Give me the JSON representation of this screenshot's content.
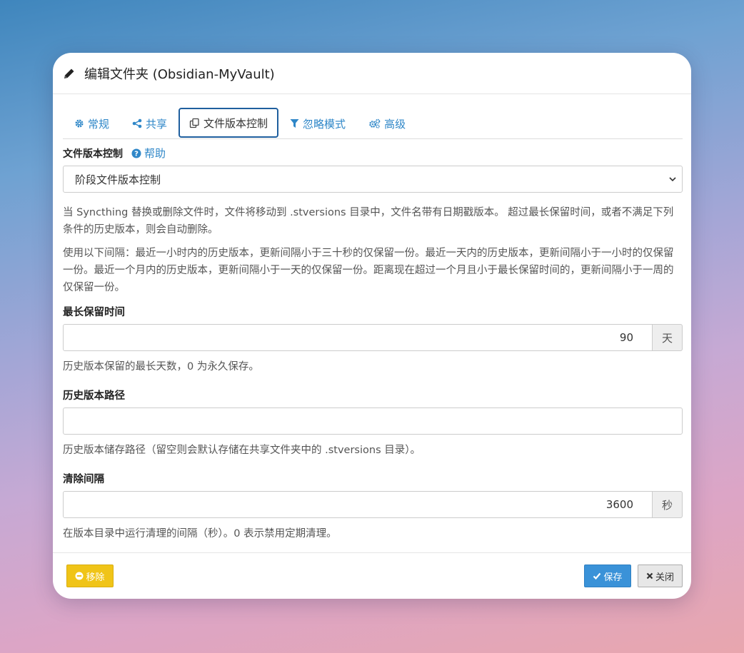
{
  "header": {
    "title": "编辑文件夹 (Obsidian-MyVault)",
    "icon": "pencil-icon"
  },
  "tabs": [
    {
      "label": "常规",
      "icon": "gear-icon",
      "active": false
    },
    {
      "label": "共享",
      "icon": "share-icon",
      "active": false
    },
    {
      "label": "文件版本控制",
      "icon": "copy-icon",
      "active": true
    },
    {
      "label": "忽略模式",
      "icon": "filter-icon",
      "active": false
    },
    {
      "label": "高级",
      "icon": "gears-icon",
      "active": false
    }
  ],
  "versioning": {
    "label": "文件版本控制",
    "help_label": "帮助",
    "select_value": "阶段文件版本控制",
    "desc1": "当 Syncthing 替换或删除文件时，文件将移动到 .stversions 目录中，文件名带有日期戳版本。 超过最长保留时间，或者不满足下列条件的历史版本，则会自动删除。",
    "desc2": "使用以下间隔：最近一小时内的历史版本，更新间隔小于三十秒的仅保留一份。最近一天内的历史版本，更新间隔小于一小时的仅保留一份。最近一个月内的历史版本，更新间隔小于一天的仅保留一份。距离现在超过一个月且小于最长保留时间的，更新间隔小于一周的仅保留一份。"
  },
  "max_age": {
    "label": "最长保留时间",
    "value": "90",
    "unit": "天",
    "help": "历史版本保留的最长天数，0 为永久保存。"
  },
  "versions_path": {
    "label": "历史版本路径",
    "value": "",
    "help": "历史版本储存路径（留空则会默认存储在共享文件夹中的 .stversions 目录）。"
  },
  "cleanup": {
    "label": "清除间隔",
    "value": "3600",
    "unit": "秒",
    "help": "在版本目录中运行清理的间隔（秒）。0 表示禁用定期清理。"
  },
  "footer": {
    "remove_label": "移除",
    "save_label": "保存",
    "close_label": "关闭"
  },
  "colors": {
    "link": "#2f87c8",
    "warning": "#f0c418",
    "primary": "#3a92d8"
  }
}
